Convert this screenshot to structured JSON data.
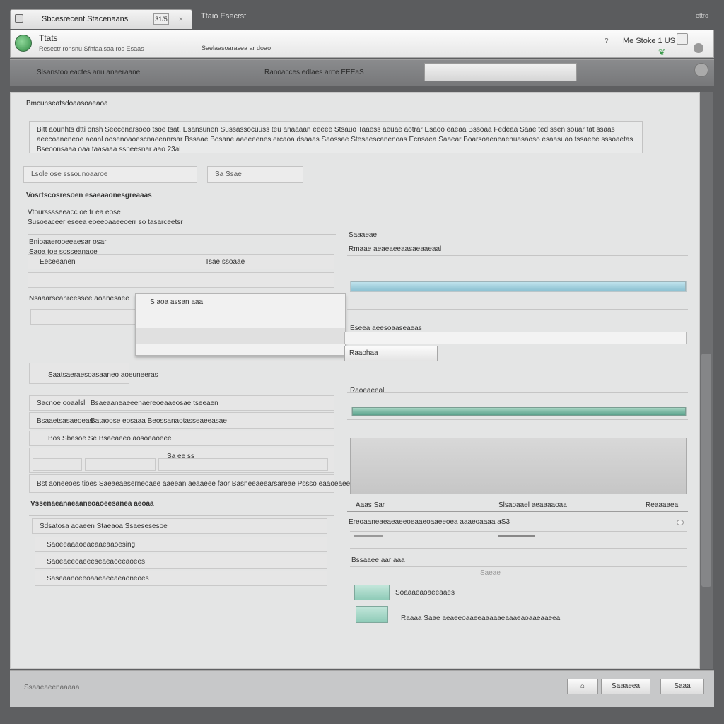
{
  "browser": {
    "tab_title": "Sbcesrecent.Stacenaans",
    "tab_count": "31/5",
    "tab_close": "×",
    "second_tab": "Ttaio Esecrst",
    "window_control": "ettro"
  },
  "header": {
    "app_name": "Ttats",
    "app_subtitle": "Resectr ronsnu Sfhfaalsaa ros Esaas",
    "link": "Saelaasoarasea ar doao",
    "help_icon": "?",
    "user": "Me Stoke 1 US",
    "leaf_icon": "❦"
  },
  "toolbar": {
    "left_text": "Slsanstoo eactes anu anaeraane",
    "mid_text": "Ranoacces edlaes arrte EEEaS"
  },
  "section_title": "Bmcunseatsdoaasoaeaoa",
  "notice_text": "Bitt aounhts dtti onsh Seecenarsoeo tsoe tsat, Esansunen Sussassocuuss teu anaaaan eeeee Stsauo Taaess aeuae aotrar Esaoo eaeaa Bssoaa Fedeaa Saae ted ssen souar tat ssaas aeecoaneneoe aeanl oosenoaoescnaeennrsar Bssaae Bosane aaeeeenes ercaoa dsaaas Saossae Stesaescanenoas Ecnsaea Saaear Boarsoaeneaenuasaoso esaasuao tssaeee sssoaetas Bseoonsaaa oaa taasaaa ssneesnar aao 23al",
  "left": {
    "field1": "Lsole ose sssounoaaroe",
    "field2": "Sa Ssae",
    "group_title": "Vosrtscosresoen esaeaaonesgreaaas",
    "group_line1": "Vtoursssseeacc oe tr ea eose",
    "group_line2": "Susoeaceer eseea eoeeoaaeeoerr so tasarceetsr",
    "sub_label": "Bnioaaerooeeaesar osar",
    "sub_label2": "Saoa toe sosseanaoe",
    "input_a": "Eeseeanen",
    "input_a_value": "Tsae ssoaae",
    "row_label": "Nsaaarseanreessee aoanesaee",
    "popup_title": "S aoa assan aaa",
    "small_btn": "Saatsaeraesoasaaneo aoeuneeras",
    "table": {
      "r1c1": "Sacnoe ooaalsl",
      "r1c2": "Bsaeaaneaeeenaereoeaaeosae tseeaen",
      "r2c1": "Bsaaetsasaeoeas",
      "r2c2": "Bataoose eosaaa Beossanaotasseaeeasae",
      "r3": "Bos Sbasoe Se Bsaeaeeo aosoeaoeee",
      "r4c3": "Sa ee ss",
      "note": "Bst aoneeoes tioes Saeaeaeserneoaee aaeean aeaaeee faor Basneeaeearsareae Pssso eaaoeaeeaeneoee"
    },
    "list_title": "Vssenaeanaeaaneoaoeesanea aeoaa",
    "list_header": "Sdsatosa aoaeen Staeaoa Ssaesesesoe",
    "list_items": [
      "Saoeeaaaoeaeaaeaaoesing",
      "Saoeaeeoaeeeseaeaoeeaoees",
      "Saseaanoeeoaaeaeeaeaoneoes"
    ]
  },
  "right": {
    "label1": "Saaaeae",
    "label2": "Rmaae aeaeaeeaasaeaaeaal",
    "label3": "Eseea aeesoaaseaeas",
    "dropdown_value": "Raaohaa",
    "label4": "Raoeaeeal",
    "progress_level": 1.0,
    "green_level": 1.0,
    "col1": "Aaas Sar",
    "col2": "Slsaoaael aeaaaaoaa",
    "col3": "Reaaaaea",
    "row_text": "Ereoaaneaeaeaeeoeaaeoaaeeoea aaaeoaaaa aS3",
    "sub_label": "Bssaaee aar aaa",
    "small_label": "Saeae",
    "thumb1_label": "Soaaaeaoaeeaaes",
    "thumb2_label": "Raaaa Saae aeaeeoaaeeaaaaaeaaaeaoaaeaaeea"
  },
  "footer": {
    "status": "Ssaaeaeenaaaaa",
    "icon_button": "⌂",
    "secondary_button": "Saaaeea",
    "primary_button": "Saaa"
  },
  "colors": {
    "progress": "#9ccbe0",
    "green_bar": "#6fb39d",
    "logo": "#3f9a52"
  }
}
